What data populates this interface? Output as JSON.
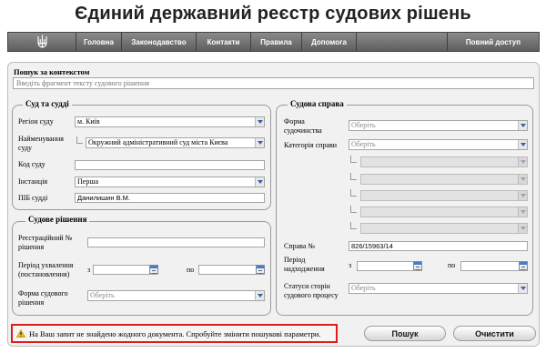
{
  "page": {
    "title": "Єдиний державний реєстр судових рішень"
  },
  "nav": {
    "items": [
      "Головна",
      "Законодавство",
      "Контакти",
      "Правила",
      "Допомога"
    ],
    "right": "Повний доступ"
  },
  "context_search": {
    "label": "Пошук за контекстом",
    "placeholder": "Введіть фрагмент тексту судового рішення"
  },
  "court": {
    "legend": "Суд та судді",
    "region_label": "Регіон суду",
    "region_value": "м. Київ",
    "name_label": "Найменування суду",
    "name_value": "Окружний адміністративний суд міста Києва",
    "code_label": "Код суду",
    "code_value": "",
    "instance_label": "Інстанція",
    "instance_value": "Перша",
    "judge_label": "ПІБ судді",
    "judge_value": "Данилишин В.М."
  },
  "decision": {
    "legend": "Судове рішення",
    "reg_label": "Реєстраційний № рішення",
    "reg_value": "",
    "period_label": "Період ухвалення (постановлення)",
    "from_label": "з",
    "to_label": "по",
    "form_label": "Форма судового рішення",
    "form_placeholder": "Оберіть"
  },
  "case": {
    "legend": "Судова справа",
    "jurisdiction_label": "Форма судочинства",
    "jurisdiction_placeholder": "Оберіть",
    "category_label": "Категорія справи",
    "category_placeholder": "Оберіть",
    "number_label": "Справа №",
    "number_value": "826/15963/14",
    "period_label": "Період надходження",
    "from_label": "з",
    "to_label": "по",
    "parties_label": "Статуси сторін судового процесу",
    "parties_placeholder": "Оберіть"
  },
  "alert": {
    "message": "На Ваш запит не знайдено жодного документа. Спробуйте змінити пошукові параметри."
  },
  "buttons": {
    "search": "Пошук",
    "clear": "Очистити"
  },
  "colors": {
    "alert_border": "#e01b1b",
    "nav_bg": "#6f6f6f",
    "panel_bg": "#f1f1f1"
  }
}
